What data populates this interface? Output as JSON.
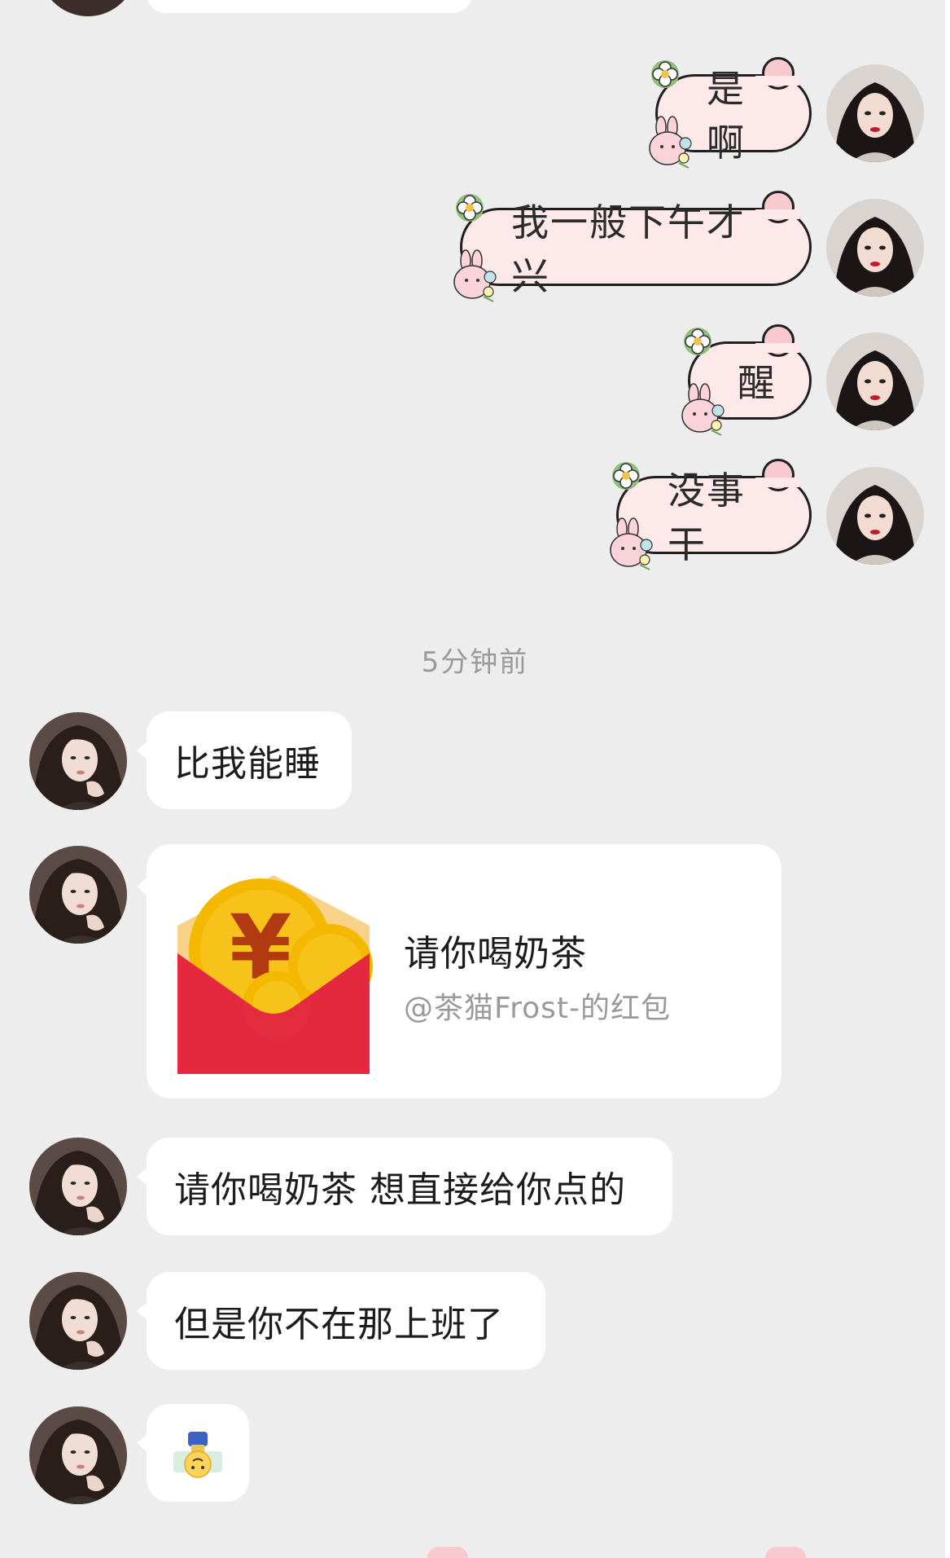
{
  "sent_messages": [
    {
      "text": "是啊"
    },
    {
      "text": "我一般下午才兴"
    },
    {
      "text": "醒"
    },
    {
      "text": "没事干"
    }
  ],
  "timestamp": "5分钟前",
  "received_messages": [
    {
      "text": "比我能睡"
    },
    {
      "text": "请你喝奶茶 想直接给你点的"
    },
    {
      "text": "但是你不在那上班了"
    }
  ],
  "red_packet": {
    "title": "请你喝奶茶",
    "subtitle": "@茶猫Frost-的红包",
    "currency_symbol": "¥",
    "colors": {
      "envelope": "#e2293f",
      "coin": "#f5b800",
      "symbol": "#b23a10"
    }
  },
  "sticker": {
    "icon": "upside-down-boy-sticker"
  },
  "colors": {
    "background": "#ededed",
    "cute_bubble": "#fde8ea",
    "received_bubble": "#ffffff",
    "timestamp": "#9a9a9a"
  }
}
